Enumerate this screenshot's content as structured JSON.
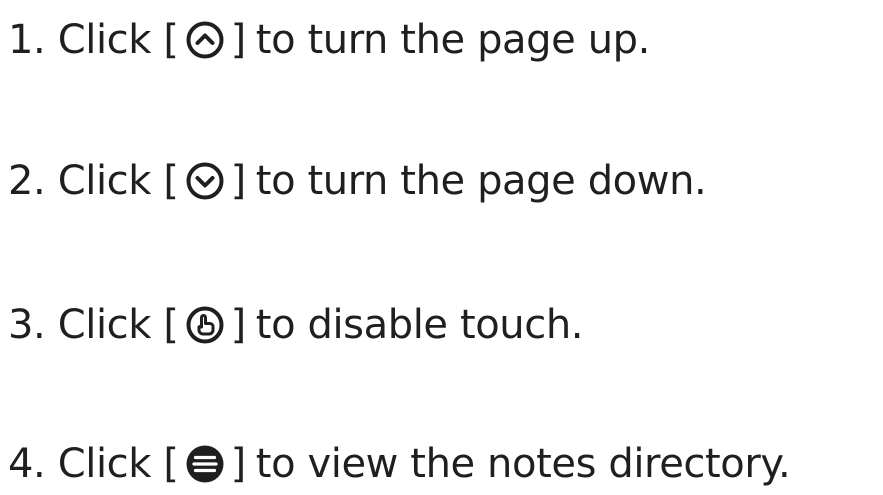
{
  "steps": [
    {
      "number": "1.",
      "verb": "Click",
      "open": "[",
      "close": "]",
      "text": "to turn the page up.",
      "icon": "chevron-up-circle-icon"
    },
    {
      "number": "2.",
      "verb": "Click",
      "open": "[",
      "close": "]",
      "text": "to turn the page down.",
      "icon": "chevron-down-circle-icon"
    },
    {
      "number": "3.",
      "verb": "Click",
      "open": "[",
      "close": "]",
      "text": "to disable touch.",
      "icon": "touch-hand-icon"
    },
    {
      "number": "4.",
      "verb": "Click",
      "open": "[",
      "close": "]",
      "text": "to view the notes directory.",
      "icon": "notes-directory-icon"
    }
  ],
  "colors": {
    "text": "#1f1f1f",
    "icon": "#1f1f1f",
    "background": "#ffffff"
  }
}
